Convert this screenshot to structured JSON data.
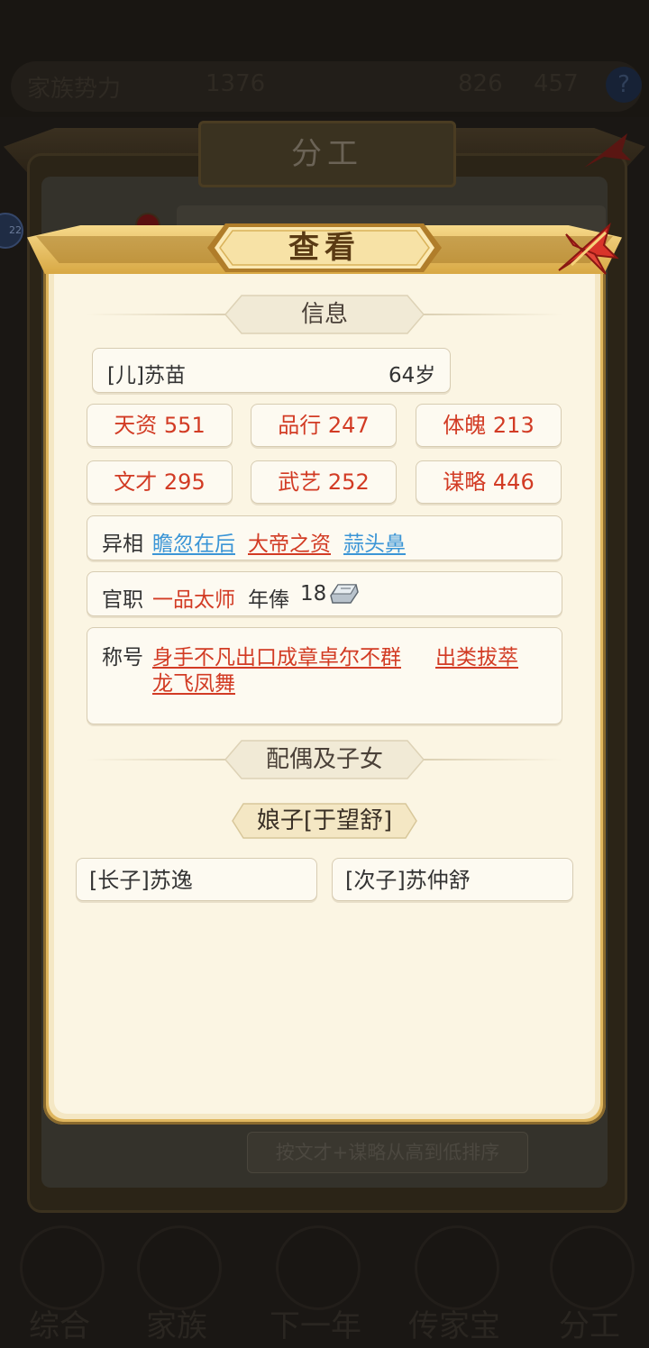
{
  "background": {
    "topbar_left": "家族势力",
    "topbar_mid": "1376",
    "topbar_right_a": "826",
    "topbar_right_b": "457",
    "badge": "22",
    "panel_title": "分工",
    "sort_label": "按文才+谋略从高到低排序",
    "nav": [
      "综合",
      "家族",
      "下一年",
      "传家宝",
      "分工"
    ]
  },
  "dialog": {
    "title": "查看",
    "info_section": "信息",
    "person": {
      "name": "[儿]苏苗",
      "age": "64岁"
    },
    "stats": [
      "天资 551",
      "品行 247",
      "体魄 213",
      "文才 295",
      "武艺 252",
      "谋略 446"
    ],
    "traits": {
      "label": "异相",
      "items": [
        "瞻忽在后",
        "大帝之资",
        "蒜头鼻"
      ]
    },
    "office": {
      "label": "官职",
      "title": "一品太师",
      "salary_label": "年俸",
      "salary_value": "18",
      "salary_icon": "silver-ingot-icon"
    },
    "honors": {
      "label": "称号",
      "items": [
        "身手不凡",
        "出口成章",
        "卓尔不群",
        "出类拔萃",
        "龙飞凤舞"
      ]
    },
    "family_section": "配偶及子女",
    "spouse": "娘子[于望舒]",
    "children": [
      "[长子]苏逸",
      "[次子]苏仲舒"
    ]
  },
  "colors": {
    "stat_red": "#d23b24",
    "trait_blue": "#3b95d6",
    "frame_gold": "#dfb65e",
    "parchment": "#fbf5e3"
  }
}
